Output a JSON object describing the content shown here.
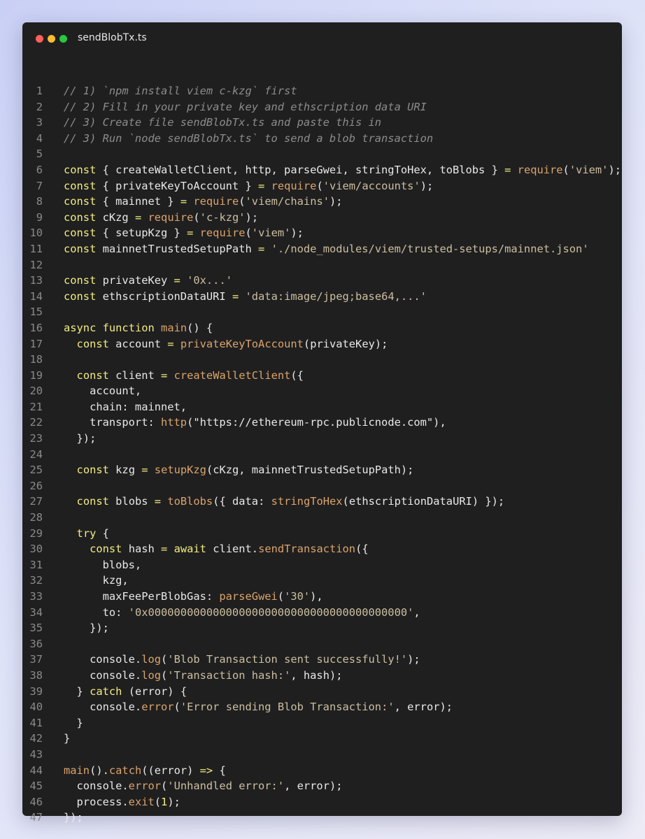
{
  "window": {
    "filename": "sendBlobTx.ts",
    "traffic_lights": [
      {
        "name": "close",
        "color": "#fe5f57"
      },
      {
        "name": "minimize",
        "color": "#febc2e"
      },
      {
        "name": "zoom",
        "color": "#28c840"
      }
    ]
  },
  "theme": {
    "comment": "#8c8c8c",
    "keyword": "#f2ed80",
    "function": "#dba46b",
    "string": "#cdbf9f",
    "number": "#f2ed80",
    "plain": "#e8e8e8"
  },
  "code": {
    "lines": [
      [
        [
          "c",
          "// 1) `npm install viem c-kzg` first"
        ]
      ],
      [
        [
          "c",
          "// 2) Fill in your private key and ethscription data URI"
        ]
      ],
      [
        [
          "c",
          "// 3) Create file sendBlobTx.ts and paste this in"
        ]
      ],
      [
        [
          "c",
          "// 3) Run `node sendBlobTx.ts` to send a blob transaction"
        ]
      ],
      [],
      [
        [
          "k",
          "const"
        ],
        [
          "p",
          " { createWalletClient, http, parseGwei, stringToHex, toBlobs } "
        ],
        [
          "k",
          "="
        ],
        [
          "p",
          " "
        ],
        [
          "f",
          "require"
        ],
        [
          "p",
          "("
        ],
        [
          "s",
          "'viem'"
        ],
        [
          "p",
          ");"
        ]
      ],
      [
        [
          "k",
          "const"
        ],
        [
          "p",
          " { privateKeyToAccount } "
        ],
        [
          "k",
          "="
        ],
        [
          "p",
          " "
        ],
        [
          "f",
          "require"
        ],
        [
          "p",
          "("
        ],
        [
          "s",
          "'viem/accounts'"
        ],
        [
          "p",
          ");"
        ]
      ],
      [
        [
          "k",
          "const"
        ],
        [
          "p",
          " { mainnet } "
        ],
        [
          "k",
          "="
        ],
        [
          "p",
          " "
        ],
        [
          "f",
          "require"
        ],
        [
          "p",
          "("
        ],
        [
          "s",
          "'viem/chains'"
        ],
        [
          "p",
          ");"
        ]
      ],
      [
        [
          "k",
          "const"
        ],
        [
          "p",
          " cKzg "
        ],
        [
          "k",
          "="
        ],
        [
          "p",
          " "
        ],
        [
          "f",
          "require"
        ],
        [
          "p",
          "("
        ],
        [
          "s",
          "'c-kzg'"
        ],
        [
          "p",
          ");"
        ]
      ],
      [
        [
          "k",
          "const"
        ],
        [
          "p",
          " { setupKzg } "
        ],
        [
          "k",
          "="
        ],
        [
          "p",
          " "
        ],
        [
          "f",
          "require"
        ],
        [
          "p",
          "("
        ],
        [
          "s",
          "'viem'"
        ],
        [
          "p",
          ");"
        ]
      ],
      [
        [
          "k",
          "const"
        ],
        [
          "p",
          " mainnetTrustedSetupPath "
        ],
        [
          "k",
          "="
        ],
        [
          "p",
          " "
        ],
        [
          "s",
          "'./node_modules/viem/trusted-setups/mainnet.json'"
        ]
      ],
      [],
      [
        [
          "k",
          "const"
        ],
        [
          "p",
          " privateKey "
        ],
        [
          "k",
          "="
        ],
        [
          "p",
          " "
        ],
        [
          "s",
          "'0x...'"
        ]
      ],
      [
        [
          "k",
          "const"
        ],
        [
          "p",
          " ethscriptionDataURI "
        ],
        [
          "k",
          "="
        ],
        [
          "p",
          " "
        ],
        [
          "s",
          "'data:image/jpeg;base64,...'"
        ]
      ],
      [],
      [
        [
          "k",
          "async"
        ],
        [
          "p",
          " "
        ],
        [
          "k",
          "function"
        ],
        [
          "p",
          " "
        ],
        [
          "f",
          "main"
        ],
        [
          "p",
          "() {"
        ]
      ],
      [
        [
          "p",
          "  "
        ],
        [
          "k",
          "const"
        ],
        [
          "p",
          " account "
        ],
        [
          "k",
          "="
        ],
        [
          "p",
          " "
        ],
        [
          "f",
          "privateKeyToAccount"
        ],
        [
          "p",
          "(privateKey);"
        ]
      ],
      [],
      [
        [
          "p",
          "  "
        ],
        [
          "k",
          "const"
        ],
        [
          "p",
          " client "
        ],
        [
          "k",
          "="
        ],
        [
          "p",
          " "
        ],
        [
          "f",
          "createWalletClient"
        ],
        [
          "p",
          "({"
        ]
      ],
      [
        [
          "p",
          "    account,"
        ]
      ],
      [
        [
          "p",
          "    chain: mainnet,"
        ]
      ],
      [
        [
          "p",
          "    transport: "
        ],
        [
          "f",
          "http"
        ],
        [
          "p",
          "(\"https://ethereum-rpc.publicnode.com\"),"
        ]
      ],
      [
        [
          "p",
          "  });"
        ]
      ],
      [],
      [
        [
          "p",
          "  "
        ],
        [
          "k",
          "const"
        ],
        [
          "p",
          " kzg "
        ],
        [
          "k",
          "="
        ],
        [
          "p",
          " "
        ],
        [
          "f",
          "setupKzg"
        ],
        [
          "p",
          "(cKzg, mainnetTrustedSetupPath);"
        ]
      ],
      [],
      [
        [
          "p",
          "  "
        ],
        [
          "k",
          "const"
        ],
        [
          "p",
          " blobs "
        ],
        [
          "k",
          "="
        ],
        [
          "p",
          " "
        ],
        [
          "f",
          "toBlobs"
        ],
        [
          "p",
          "({ data: "
        ],
        [
          "f",
          "stringToHex"
        ],
        [
          "p",
          "(ethscriptionDataURI) });"
        ]
      ],
      [],
      [
        [
          "p",
          "  "
        ],
        [
          "k",
          "try"
        ],
        [
          "p",
          " {"
        ]
      ],
      [
        [
          "p",
          "    "
        ],
        [
          "k",
          "const"
        ],
        [
          "p",
          " hash "
        ],
        [
          "k",
          "="
        ],
        [
          "p",
          " "
        ],
        [
          "k",
          "await"
        ],
        [
          "p",
          " client."
        ],
        [
          "f",
          "sendTransaction"
        ],
        [
          "p",
          "({"
        ]
      ],
      [
        [
          "p",
          "      blobs,"
        ]
      ],
      [
        [
          "p",
          "      kzg,"
        ]
      ],
      [
        [
          "p",
          "      maxFeePerBlobGas: "
        ],
        [
          "f",
          "parseGwei"
        ],
        [
          "p",
          "("
        ],
        [
          "s",
          "'30'"
        ],
        [
          "p",
          "),"
        ]
      ],
      [
        [
          "p",
          "      to: "
        ],
        [
          "s",
          "'0x0000000000000000000000000000000000000000'"
        ],
        [
          "p",
          ","
        ]
      ],
      [
        [
          "p",
          "    });"
        ]
      ],
      [],
      [
        [
          "p",
          "    console."
        ],
        [
          "f",
          "log"
        ],
        [
          "p",
          "("
        ],
        [
          "s",
          "'Blob Transaction sent successfully!'"
        ],
        [
          "p",
          ");"
        ]
      ],
      [
        [
          "p",
          "    console."
        ],
        [
          "f",
          "log"
        ],
        [
          "p",
          "("
        ],
        [
          "s",
          "'Transaction hash:'"
        ],
        [
          "p",
          ", hash);"
        ]
      ],
      [
        [
          "p",
          "  } "
        ],
        [
          "k",
          "catch"
        ],
        [
          "p",
          " (error) {"
        ]
      ],
      [
        [
          "p",
          "    console."
        ],
        [
          "f",
          "error"
        ],
        [
          "p",
          "("
        ],
        [
          "s",
          "'Error sending Blob Transaction:'"
        ],
        [
          "p",
          ", error);"
        ]
      ],
      [
        [
          "p",
          "  }"
        ]
      ],
      [
        [
          "p",
          "}"
        ]
      ],
      [],
      [
        [
          "f",
          "main"
        ],
        [
          "p",
          "()."
        ],
        [
          "f",
          "catch"
        ],
        [
          "p",
          "((error) "
        ],
        [
          "k",
          "=>"
        ],
        [
          "p",
          " {"
        ]
      ],
      [
        [
          "p",
          "  console."
        ],
        [
          "f",
          "error"
        ],
        [
          "p",
          "("
        ],
        [
          "s",
          "'Unhandled error:'"
        ],
        [
          "p",
          ", error);"
        ]
      ],
      [
        [
          "p",
          "  process."
        ],
        [
          "f",
          "exit"
        ],
        [
          "p",
          "("
        ],
        [
          "n",
          "1"
        ],
        [
          "p",
          ");"
        ]
      ],
      [
        [
          "p",
          "});"
        ]
      ]
    ]
  }
}
